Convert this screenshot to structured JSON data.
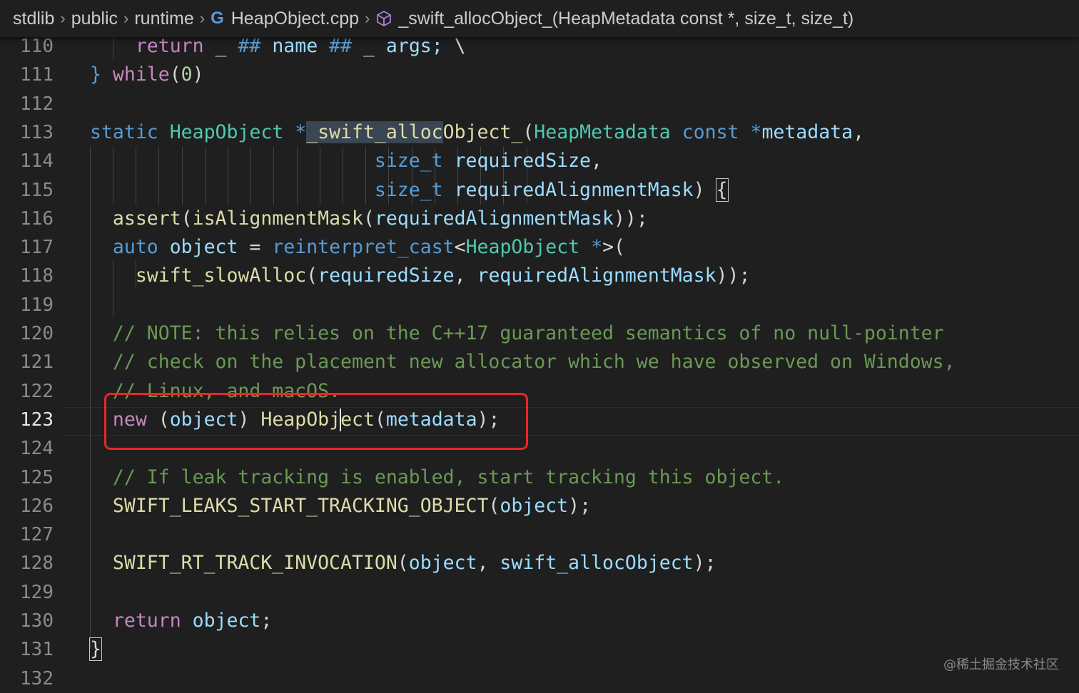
{
  "breadcrumb": {
    "items": [
      "stdlib",
      "public",
      "runtime"
    ],
    "file": "HeapObject.cpp",
    "symbol": "_swift_allocObject_(HeapMetadata const *, size_t, size_t)"
  },
  "editor": {
    "current_line": 123,
    "lines": [
      {
        "n": "110",
        "tokens": [
          {
            "t": "    "
          },
          {
            "t": "return",
            "c": "ctl"
          },
          {
            "t": " _ "
          },
          {
            "t": "##",
            "c": "kw"
          },
          {
            "t": " "
          },
          {
            "t": "name",
            "c": "var"
          },
          {
            "t": " "
          },
          {
            "t": "##",
            "c": "kw"
          },
          {
            "t": " _ "
          },
          {
            "t": "args;",
            "c": "var"
          },
          {
            "t": " \\"
          }
        ]
      },
      {
        "n": "111",
        "tokens": [
          {
            "t": "} ",
            "c": "kw"
          },
          {
            "t": "while",
            "c": "ctl"
          },
          {
            "t": "("
          },
          {
            "t": "0",
            "c": "num"
          },
          {
            "t": ")"
          }
        ]
      },
      {
        "n": "112",
        "tokens": []
      },
      {
        "n": "113",
        "tokens": [
          {
            "t": "static",
            "c": "kw"
          },
          {
            "t": " "
          },
          {
            "t": "HeapObject",
            "c": "ty"
          },
          {
            "t": " "
          },
          {
            "t": "*",
            "c": "kw"
          },
          {
            "t": "_swift_alloc",
            "c": "fn sel"
          },
          {
            "t": "Object_",
            "c": "fn"
          },
          {
            "t": "("
          },
          {
            "t": "HeapMetadata",
            "c": "ty"
          },
          {
            "t": " "
          },
          {
            "t": "const",
            "c": "kw"
          },
          {
            "t": " "
          },
          {
            "t": "*",
            "c": "kw"
          },
          {
            "t": "metadata",
            "c": "var"
          },
          {
            "t": ","
          }
        ]
      },
      {
        "n": "114",
        "tokens": [
          {
            "t": "                         "
          },
          {
            "t": "size_t",
            "c": "kw"
          },
          {
            "t": " "
          },
          {
            "t": "requiredSize",
            "c": "var"
          },
          {
            "t": ","
          }
        ]
      },
      {
        "n": "115",
        "tokens": [
          {
            "t": "                         "
          },
          {
            "t": "size_t",
            "c": "kw"
          },
          {
            "t": " "
          },
          {
            "t": "requiredAlignmentMask",
            "c": "var"
          },
          {
            "t": ") "
          },
          {
            "t": "{",
            "c": "brace-box"
          }
        ]
      },
      {
        "n": "116",
        "tokens": [
          {
            "t": "  "
          },
          {
            "t": "assert",
            "c": "fn"
          },
          {
            "t": "("
          },
          {
            "t": "isAlignmentMask",
            "c": "fn"
          },
          {
            "t": "("
          },
          {
            "t": "requiredAlignmentMask",
            "c": "var"
          },
          {
            "t": "));"
          }
        ]
      },
      {
        "n": "117",
        "tokens": [
          {
            "t": "  "
          },
          {
            "t": "auto",
            "c": "kw"
          },
          {
            "t": " "
          },
          {
            "t": "object",
            "c": "var"
          },
          {
            "t": " = "
          },
          {
            "t": "reinterpret_cast",
            "c": "kw"
          },
          {
            "t": "<"
          },
          {
            "t": "HeapObject",
            "c": "ty"
          },
          {
            "t": " "
          },
          {
            "t": "*",
            "c": "kw"
          },
          {
            "t": ">("
          }
        ]
      },
      {
        "n": "118",
        "tokens": [
          {
            "t": "    "
          },
          {
            "t": "swift_slowAlloc",
            "c": "fn"
          },
          {
            "t": "("
          },
          {
            "t": "requiredSize",
            "c": "var"
          },
          {
            "t": ", "
          },
          {
            "t": "requiredAlignmentMask",
            "c": "var"
          },
          {
            "t": "));"
          }
        ]
      },
      {
        "n": "119",
        "tokens": []
      },
      {
        "n": "120",
        "tokens": [
          {
            "t": "  // NOTE: this relies on the C++17 guaranteed semantics of no null-pointer",
            "c": "cm"
          }
        ]
      },
      {
        "n": "121",
        "tokens": [
          {
            "t": "  // check on the placement new allocator which we have observed on Windows,",
            "c": "cm"
          }
        ]
      },
      {
        "n": "122",
        "tokens": [
          {
            "t": "  // Linux, and macOS.",
            "c": "cm"
          }
        ]
      },
      {
        "n": "123",
        "tokens": [
          {
            "t": "  "
          },
          {
            "t": "new",
            "c": "ctl"
          },
          {
            "t": " ("
          },
          {
            "t": "object",
            "c": "var"
          },
          {
            "t": ") "
          },
          {
            "t": "HeapObj",
            "c": "fn"
          },
          {
            "t": "",
            "c": "caret"
          },
          {
            "t": "ect",
            "c": "fn"
          },
          {
            "t": "("
          },
          {
            "t": "metadata",
            "c": "var"
          },
          {
            "t": ");"
          }
        ]
      },
      {
        "n": "124",
        "tokens": []
      },
      {
        "n": "125",
        "tokens": [
          {
            "t": "  // If leak tracking is enabled, start tracking this object.",
            "c": "cm"
          }
        ]
      },
      {
        "n": "126",
        "tokens": [
          {
            "t": "  "
          },
          {
            "t": "SWIFT_LEAKS_START_TRACKING_OBJECT",
            "c": "fn"
          },
          {
            "t": "("
          },
          {
            "t": "object",
            "c": "var"
          },
          {
            "t": ");"
          }
        ]
      },
      {
        "n": "127",
        "tokens": []
      },
      {
        "n": "128",
        "tokens": [
          {
            "t": "  "
          },
          {
            "t": "SWIFT_RT_TRACK_INVOCATION",
            "c": "fn"
          },
          {
            "t": "("
          },
          {
            "t": "object",
            "c": "var"
          },
          {
            "t": ", "
          },
          {
            "t": "swift_allocObject",
            "c": "var"
          },
          {
            "t": ");"
          }
        ]
      },
      {
        "n": "129",
        "tokens": []
      },
      {
        "n": "130",
        "tokens": [
          {
            "t": "  "
          },
          {
            "t": "return",
            "c": "ctl"
          },
          {
            "t": " "
          },
          {
            "t": "object",
            "c": "var"
          },
          {
            "t": ";"
          }
        ]
      },
      {
        "n": "131",
        "tokens": [
          {
            "t": "}",
            "c": "brace-box"
          }
        ]
      },
      {
        "n": "132",
        "tokens": []
      }
    ]
  },
  "watermark": "@稀土掘金技术社区",
  "colors": {
    "background": "#1f1f1f",
    "keyword": "#569cd6",
    "control": "#c586c0",
    "type": "#4ec9b0",
    "function": "#dcdcaa",
    "variable": "#9cdcfe",
    "comment": "#6a9955",
    "highlight_box": "#e8262a"
  }
}
